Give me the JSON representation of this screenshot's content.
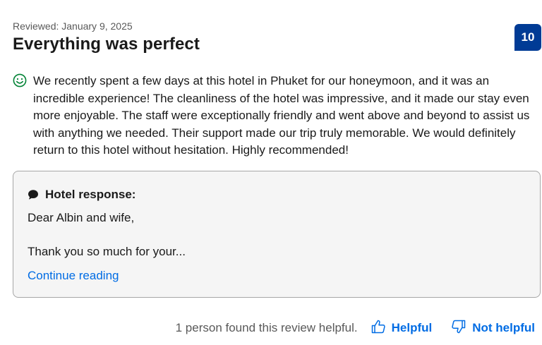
{
  "review": {
    "reviewed_date": "Reviewed: January 9, 2025",
    "title": "Everything was perfect",
    "score": "10",
    "sentiment_icon": "smile-icon",
    "text": "We recently spent a few days at this hotel in Phuket for our honeymoon, and it was an incredible experience! The cleanliness of the hotel was impressive, and it made our stay even more enjoyable. The staff were exceptionally friendly and went above and beyond to assist us with anything we needed. Their support made our trip truly memorable. We would definitely return to this hotel without hesitation. Highly recommended!"
  },
  "hotel_response": {
    "label": "Hotel response:",
    "greeting": "Dear Albin and wife,",
    "text": "Thank you so much for your...",
    "continue_label": "Continue reading"
  },
  "footer": {
    "helpful_count_text": "1 person found this review helpful.",
    "helpful_label": "Helpful",
    "not_helpful_label": "Not helpful"
  },
  "colors": {
    "score_badge": "#003b95",
    "link": "#006ce4",
    "positive": "#008234",
    "response_bg": "#f5f5f5"
  }
}
